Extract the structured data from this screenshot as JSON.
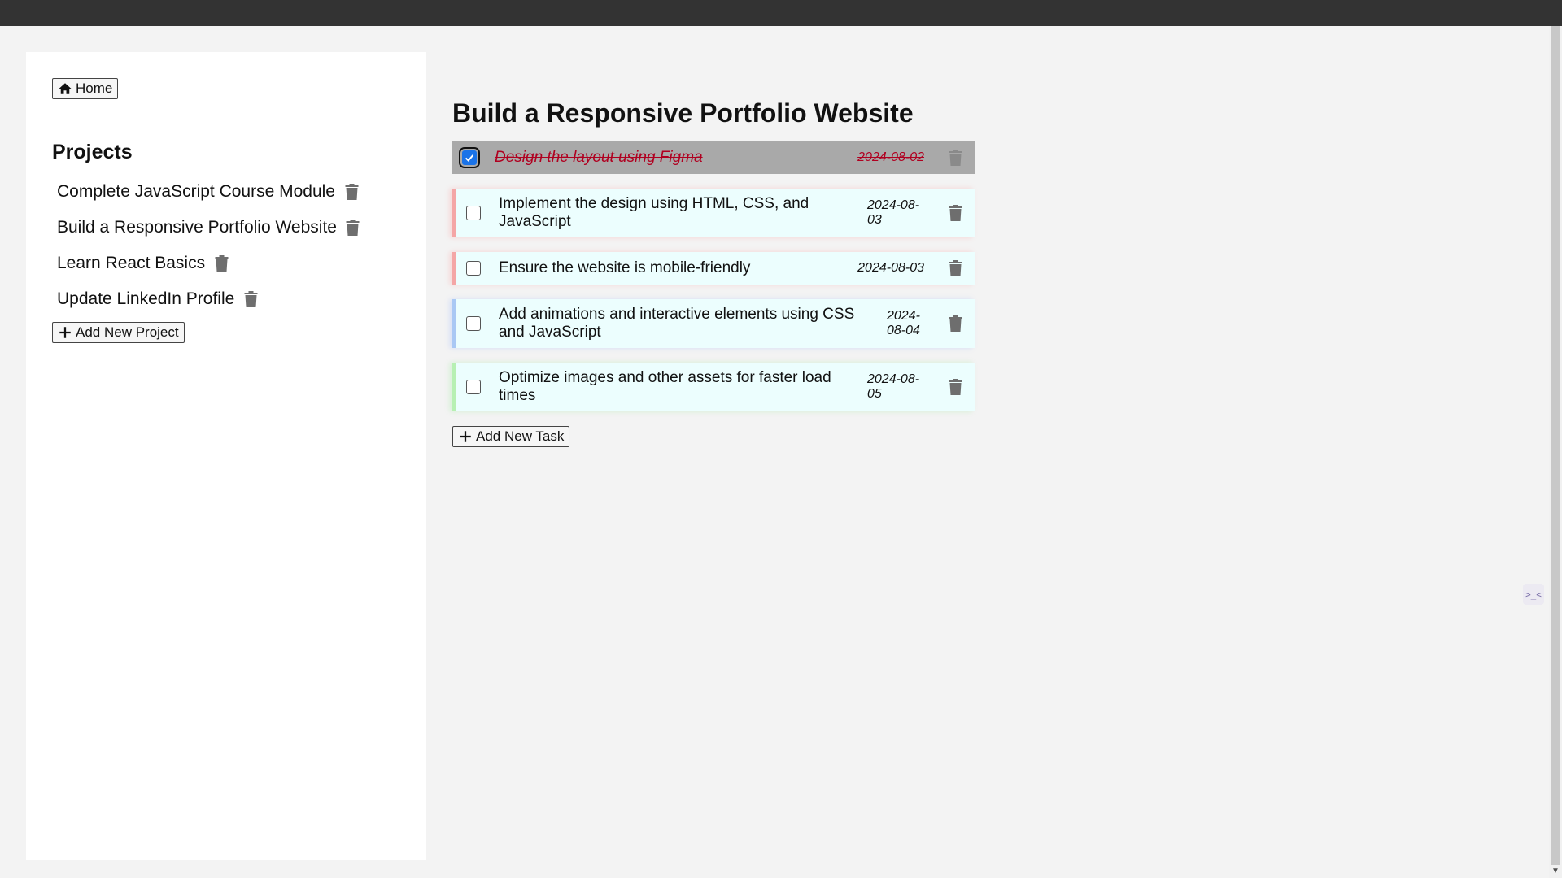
{
  "nav": {
    "home_label": "Home"
  },
  "sidebar": {
    "projects_title": "Projects",
    "projects": [
      {
        "name": "Complete JavaScript Course Module"
      },
      {
        "name": "Build a Responsive Portfolio Website"
      },
      {
        "name": "Learn React Basics"
      },
      {
        "name": "Update LinkedIn Profile"
      }
    ],
    "add_project_label": "Add New Project"
  },
  "project": {
    "title": "Build a Responsive Portfolio Website",
    "tasks": [
      {
        "text": "Design the layout using Figma",
        "date": "2024-08-02",
        "done": true
      },
      {
        "text": "Implement the design using HTML, CSS, and JavaScript",
        "date": "2024-08-03",
        "done": false
      },
      {
        "text": "Ensure the website is mobile-friendly",
        "date": "2024-08-03",
        "done": false
      },
      {
        "text": "Add animations and interactive elements using CSS and JavaScript",
        "date": "2024-08-04",
        "done": false
      },
      {
        "text": "Optimize images and other assets for faster load times",
        "date": "2024-08-05",
        "done": false
      }
    ],
    "add_task_label": "Add New Task"
  },
  "colors": {
    "task_background": "#ecfefe",
    "done_background": "#a9a9a9",
    "done_text": "#b00020",
    "checkbox_checked": "#1a73e8"
  },
  "icons": {
    "home": "home-icon",
    "trash": "trash-icon",
    "plus": "plus-icon",
    "check": "check-icon"
  }
}
